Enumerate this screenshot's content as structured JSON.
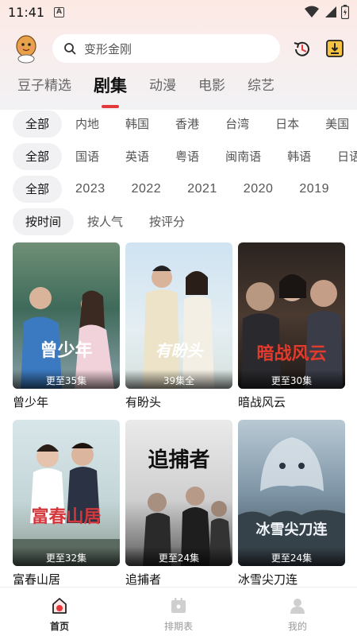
{
  "status_bar": {
    "time": "11:41",
    "notification_letter": "A"
  },
  "search": {
    "placeholder": "变形金刚"
  },
  "top_tabs": [
    {
      "label": "豆子精选",
      "active": false
    },
    {
      "label": "剧集",
      "active": true
    },
    {
      "label": "动漫",
      "active": false
    },
    {
      "label": "电影",
      "active": false
    },
    {
      "label": "综艺",
      "active": false
    }
  ],
  "filters": {
    "region": [
      "全部",
      "内地",
      "韩国",
      "香港",
      "台湾",
      "日本",
      "美国"
    ],
    "language": [
      "全部",
      "国语",
      "英语",
      "粤语",
      "闽南语",
      "韩语",
      "日语"
    ],
    "year": [
      "全部",
      "2023",
      "2022",
      "2021",
      "2020",
      "2019"
    ],
    "sort": [
      "按时间",
      "按人气",
      "按评分"
    ]
  },
  "shows": [
    {
      "title": "曾少年",
      "episodes": "更至35集",
      "poster_text": "曾少年"
    },
    {
      "title": "有盼头",
      "episodes": "39集全",
      "poster_text": "有盼头"
    },
    {
      "title": "暗战风云",
      "episodes": "更至30集",
      "poster_text": "暗战风云"
    },
    {
      "title": "富春山居",
      "episodes": "更至32集",
      "poster_text": "富春山居"
    },
    {
      "title": "追捕者",
      "episodes": "更至24集",
      "poster_text": "追捕者"
    },
    {
      "title": "冰雪尖刀连",
      "episodes": "更至24集",
      "poster_text": "冰雪尖刀连"
    }
  ],
  "bottom_nav": [
    {
      "label": "首页",
      "icon": "home-icon",
      "active": true
    },
    {
      "label": "排期表",
      "icon": "calendar-icon",
      "active": false
    },
    {
      "label": "我的",
      "icon": "profile-icon",
      "active": false
    }
  ],
  "colors": {
    "accent": "#e5383b",
    "chip_bg": "#f1f1f3"
  }
}
